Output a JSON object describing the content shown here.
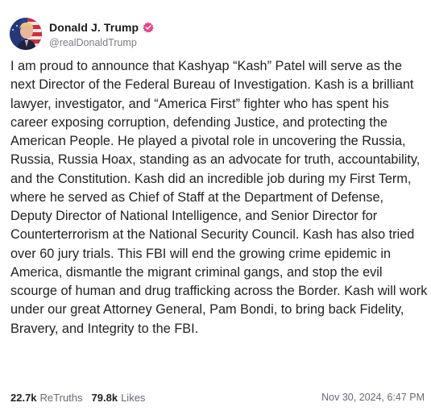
{
  "author": {
    "display_name": "Donald J. Trump",
    "handle": "@realDonaldTrump",
    "verified_color": "#e8458b",
    "avatar_icon": "profile-avatar"
  },
  "post": {
    "text": "I am proud to announce that Kashyap “Kash” Patel will serve as the next Director of the Federal Bureau of Investigation. Kash is a brilliant lawyer, investigator, and “America First” fighter who has spent his career exposing corruption, defending Justice, and protecting the American People. He played a pivotal role in uncovering the Russia, Russia, Russia Hoax, standing as an advocate for truth, accountability, and the Constitution. Kash did an incredible job during my First Term, where he served as Chief of Staff at the Department of Defense, Deputy Director of National Intelligence, and Senior Director for Counterterrorism at the National Security Council. Kash has also tried over 60 jury trials. This FBI will end the growing crime epidemic in America, dismantle the migrant criminal gangs, and stop the evil scourge of human and drug trafficking across the Border. Kash will work under our great Attorney General, Pam Bondi, to bring back Fidelity, Bravery, and Integrity to the FBI."
  },
  "stats": {
    "retruths_count": "22.7k",
    "retruths_label": "ReTruths",
    "likes_count": "79.8k",
    "likes_label": "Likes"
  },
  "timestamp": "Nov 30, 2024, 6:47 PM"
}
